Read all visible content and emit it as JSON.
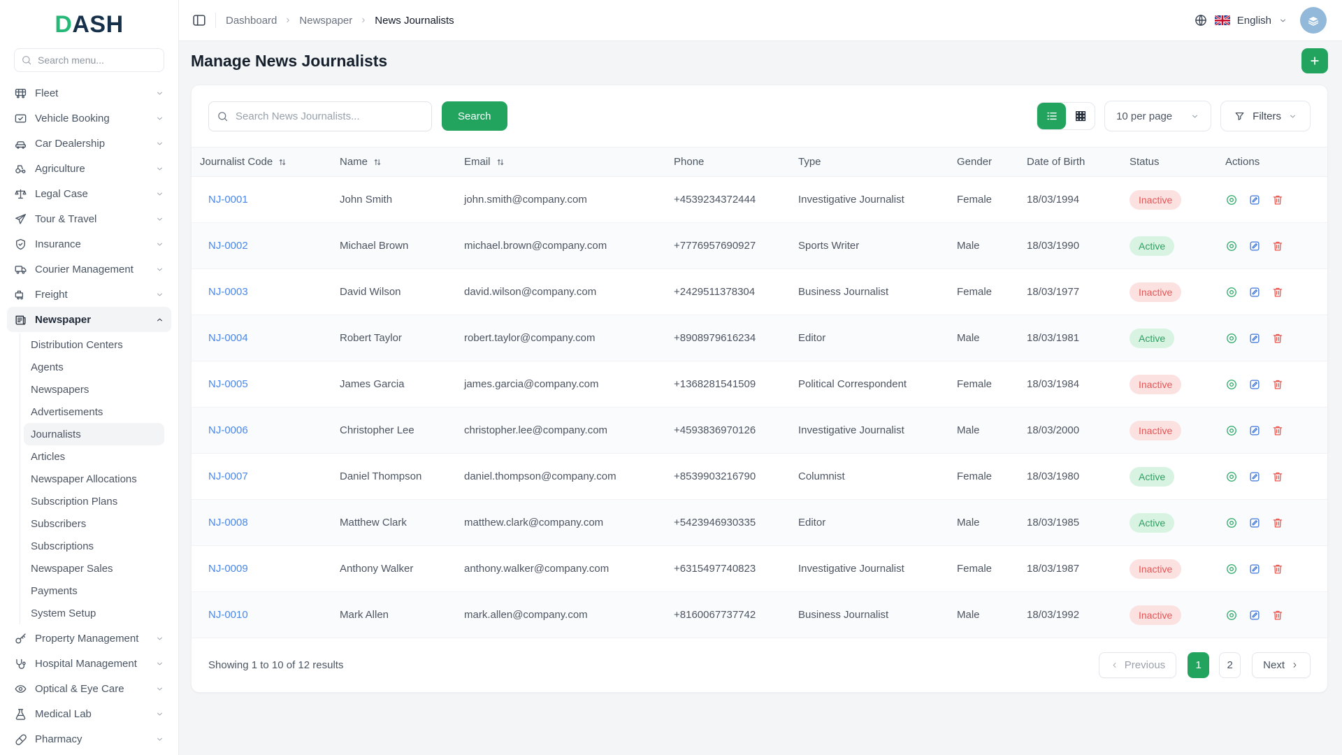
{
  "app": {
    "logo_d": "D",
    "logo_rest": "ASH"
  },
  "colors": {
    "primary_green": "#22a45f",
    "link_blue": "#4a87e8",
    "status_active_bg": "#d9f3e3",
    "status_active_text": "#2e9e60",
    "status_inactive_bg": "#fce1e1",
    "status_inactive_text": "#e25656",
    "logo_green": "#25b877",
    "logo_dark": "#16304a",
    "avatar_bg": "#92b9d9"
  },
  "sidebar": {
    "search_placeholder": "Search menu...",
    "sections_top": [
      {
        "label": "Fleet",
        "icon": "fleet-icon"
      },
      {
        "label": "Vehicle Booking",
        "icon": "vehicle-booking-icon"
      },
      {
        "label": "Car Dealership",
        "icon": "car-dealership-icon"
      },
      {
        "label": "Agriculture",
        "icon": "agriculture-icon"
      },
      {
        "label": "Legal Case",
        "icon": "legal-case-icon"
      },
      {
        "label": "Tour & Travel",
        "icon": "tour-travel-icon"
      },
      {
        "label": "Insurance",
        "icon": "insurance-icon"
      },
      {
        "label": "Courier Management",
        "icon": "courier-management-icon"
      },
      {
        "label": "Freight",
        "icon": "freight-icon"
      }
    ],
    "newspaper": {
      "label": "Newspaper",
      "icon": "newspaper-icon",
      "children": [
        {
          "label": "Distribution Centers"
        },
        {
          "label": "Agents"
        },
        {
          "label": "Newspapers"
        },
        {
          "label": "Advertisements"
        },
        {
          "label": "Journalists",
          "active": true
        },
        {
          "label": "Articles"
        },
        {
          "label": "Newspaper Allocations"
        },
        {
          "label": "Subscription Plans"
        },
        {
          "label": "Subscribers"
        },
        {
          "label": "Subscriptions"
        },
        {
          "label": "Newspaper Sales"
        },
        {
          "label": "Payments"
        },
        {
          "label": "System Setup"
        }
      ]
    },
    "sections_bottom": [
      {
        "label": "Property Management",
        "icon": "property-management-icon"
      },
      {
        "label": "Hospital Management",
        "icon": "hospital-management-icon"
      },
      {
        "label": "Optical & Eye Care",
        "icon": "optical-eye-care-icon"
      },
      {
        "label": "Medical Lab",
        "icon": "medical-lab-icon"
      },
      {
        "label": "Pharmacy",
        "icon": "pharmacy-icon"
      }
    ]
  },
  "topbar": {
    "breadcrumb": [
      "Dashboard",
      "Newspaper",
      "News Journalists"
    ],
    "language": "English"
  },
  "page": {
    "title": "Manage News Journalists"
  },
  "toolbar": {
    "search_placeholder": "Search News Journalists...",
    "search_button": "Search",
    "per_page": "10 per page",
    "filters_label": "Filters"
  },
  "table": {
    "columns": [
      {
        "label": "Journalist Code",
        "sortable": true
      },
      {
        "label": "Name",
        "sortable": true
      },
      {
        "label": "Email",
        "sortable": true
      },
      {
        "label": "Phone",
        "sortable": false
      },
      {
        "label": "Type",
        "sortable": false
      },
      {
        "label": "Gender",
        "sortable": false
      },
      {
        "label": "Date of Birth",
        "sortable": false
      },
      {
        "label": "Status",
        "sortable": false
      },
      {
        "label": "Actions",
        "sortable": false
      }
    ],
    "action_icons": [
      "eye-icon",
      "edit-icon",
      "trash-icon"
    ],
    "rows": [
      {
        "code": "NJ-0001",
        "name": "John Smith",
        "email": "john.smith@company.com",
        "phone": "+4539234372444",
        "type": "Investigative Journalist",
        "gender": "Female",
        "dob": "18/03/1994",
        "status": "Inactive"
      },
      {
        "code": "NJ-0002",
        "name": "Michael Brown",
        "email": "michael.brown@company.com",
        "phone": "+7776957690927",
        "type": "Sports Writer",
        "gender": "Male",
        "dob": "18/03/1990",
        "status": "Active"
      },
      {
        "code": "NJ-0003",
        "name": "David Wilson",
        "email": "david.wilson@company.com",
        "phone": "+2429511378304",
        "type": "Business Journalist",
        "gender": "Female",
        "dob": "18/03/1977",
        "status": "Inactive"
      },
      {
        "code": "NJ-0004",
        "name": "Robert Taylor",
        "email": "robert.taylor@company.com",
        "phone": "+8908979616234",
        "type": "Editor",
        "gender": "Male",
        "dob": "18/03/1981",
        "status": "Active"
      },
      {
        "code": "NJ-0005",
        "name": "James Garcia",
        "email": "james.garcia@company.com",
        "phone": "+1368281541509",
        "type": "Political Correspondent",
        "gender": "Female",
        "dob": "18/03/1984",
        "status": "Inactive"
      },
      {
        "code": "NJ-0006",
        "name": "Christopher Lee",
        "email": "christopher.lee@company.com",
        "phone": "+4593836970126",
        "type": "Investigative Journalist",
        "gender": "Male",
        "dob": "18/03/2000",
        "status": "Inactive"
      },
      {
        "code": "NJ-0007",
        "name": "Daniel Thompson",
        "email": "daniel.thompson@company.com",
        "phone": "+8539903216790",
        "type": "Columnist",
        "gender": "Female",
        "dob": "18/03/1980",
        "status": "Active"
      },
      {
        "code": "NJ-0008",
        "name": "Matthew Clark",
        "email": "matthew.clark@company.com",
        "phone": "+5423946930335",
        "type": "Editor",
        "gender": "Male",
        "dob": "18/03/1985",
        "status": "Active"
      },
      {
        "code": "NJ-0009",
        "name": "Anthony Walker",
        "email": "anthony.walker@company.com",
        "phone": "+6315497740823",
        "type": "Investigative Journalist",
        "gender": "Female",
        "dob": "18/03/1987",
        "status": "Inactive"
      },
      {
        "code": "NJ-0010",
        "name": "Mark Allen",
        "email": "mark.allen@company.com",
        "phone": "+8160067737742",
        "type": "Business Journalist",
        "gender": "Male",
        "dob": "18/03/1992",
        "status": "Inactive"
      }
    ]
  },
  "pagination": {
    "summary": "Showing 1 to 10 of 12 results",
    "previous_label": "Previous",
    "next_label": "Next",
    "pages": [
      {
        "label": "1",
        "active": true
      },
      {
        "label": "2",
        "active": false
      }
    ]
  }
}
